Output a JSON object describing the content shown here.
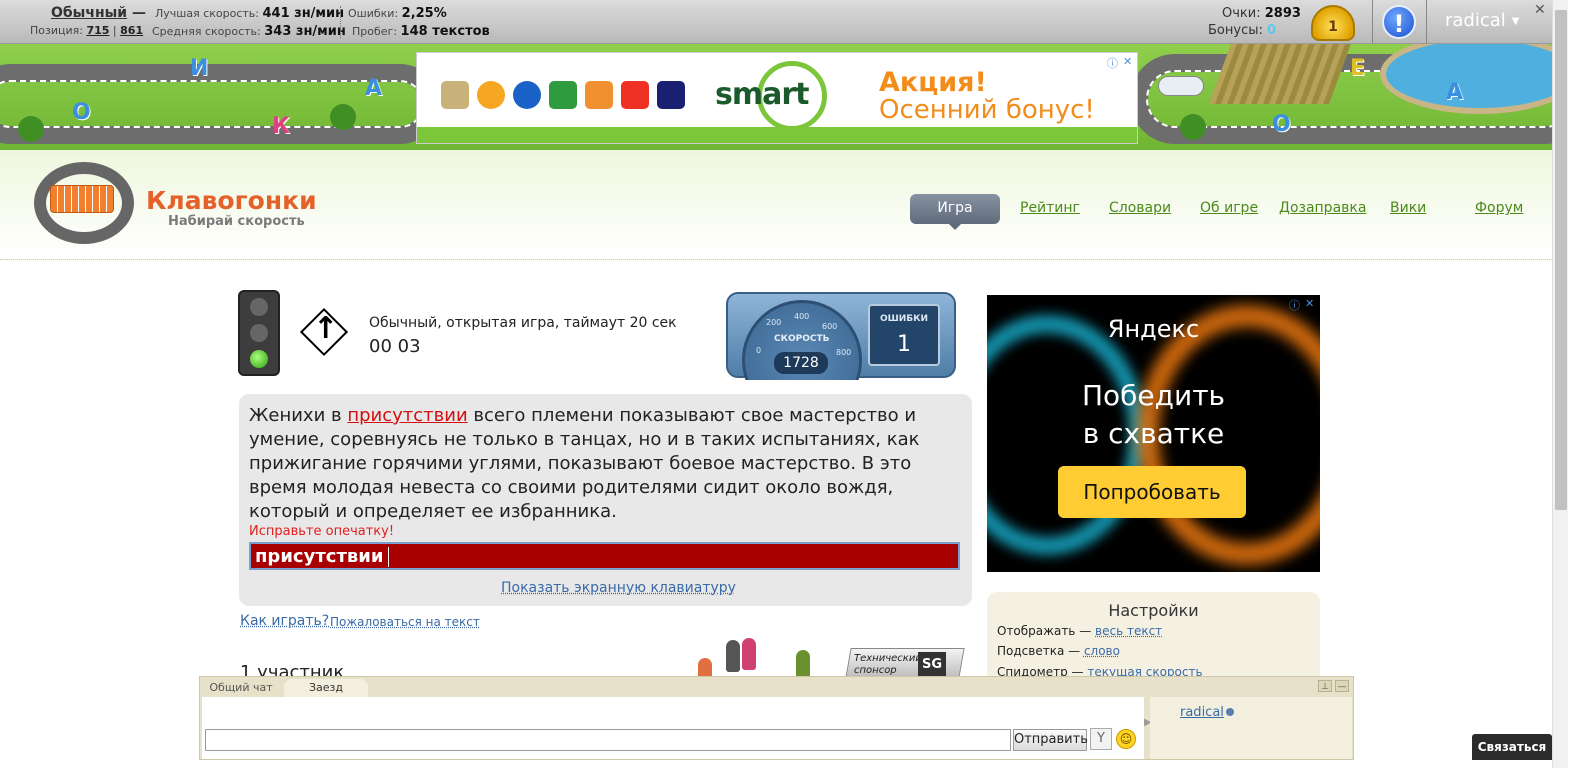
{
  "topbar": {
    "mode_label": "Обычный",
    "mode_dash": " —",
    "position_label": "Позиция: ",
    "position_current": "715",
    "position_sep": " | ",
    "position_total": "861",
    "best_speed_label": "Лучшая скорость: ",
    "best_speed_value": "441 зн/мин",
    "avg_speed_label": "Средняя скорость: ",
    "avg_speed_value": "343 зн/мин",
    "errors_label": "Ошибки: ",
    "errors_value": "2,25%",
    "mileage_label": "Пробег: ",
    "mileage_value": "148 текстов",
    "points_label": "Очки: ",
    "points_value": "2893",
    "bonus_label": "Бонусы: ",
    "bonus_value": "0",
    "level_badge": "1",
    "alert_symbol": "!",
    "username": "radical",
    "caret": "▼",
    "close_symbol": "✕"
  },
  "banner": {
    "letters": [
      "О",
      "И",
      "А",
      "К",
      "Е",
      "А",
      "О"
    ],
    "ad_title": "Акция!",
    "ad_subtitle": "Осенний бонус!",
    "ad_brand": "smart",
    "ad_ctl_info": "ⓘ",
    "ad_ctl_close": "✕",
    "payment_icons": [
      "tinkoff-icon",
      "qiwi-icon",
      "webmoney-icon",
      "sberbank-icon",
      "yandex-money-icon",
      "alfa-bank-icon",
      "visa-mastercard-icon"
    ]
  },
  "header": {
    "logo_title": "Клавогонки",
    "logo_subtitle": "Набирай скорость",
    "nav": {
      "game": "Игра",
      "rating": "Рейтинг",
      "dictionaries": "Словари",
      "about": "Об игре",
      "refuel": "Дозаправка",
      "wiki": "Вики",
      "forum": "Форум"
    }
  },
  "game": {
    "description": "Обычный, открытая игра, таймаут 20 сек",
    "timer": "00 03",
    "speedometer": {
      "caption": "СКОРОСТЬ",
      "value": "1728",
      "scale_labels": [
        "0",
        "200",
        "400",
        "600",
        "800"
      ]
    },
    "errors": {
      "caption": "ОШИБКИ",
      "value": "1"
    },
    "text_before": "Женихи в ",
    "text_current": "присутствии",
    "text_after": " всего племени показывают свое мастерство и умение, соревнуясь не только в танцах, но и в таких испытаниях, как прижигание горячими углями, показывают боевое мастерство. В это время молодая невеста со своими родителями сидит около вождя, который и определяет ее избранника.",
    "typo_message": "Исправьте опечатку!",
    "input_value": "присутствии",
    "show_keyboard_link": "Показать экранную клавиатуру",
    "how_to_play_link": "Как играть?",
    "complain_link": "Пожаловаться на текст",
    "participants": "1 участник",
    "sponsor_text": "Технический спонсор",
    "sponsor_logo": "SG"
  },
  "side_ad": {
    "brand": "Яндекс",
    "headline_line1": "Победить",
    "headline_line2": "в схватке",
    "button": "Попробовать",
    "ctl_info": "ⓘ",
    "ctl_close": "✕"
  },
  "settings": {
    "title": "Настройки",
    "rows": [
      {
        "label": "Отображать — ",
        "value": "весь текст"
      },
      {
        "label": "Подсветка — ",
        "value": "слово"
      },
      {
        "label": "Спидометр — ",
        "value": "текущая скорость"
      }
    ]
  },
  "chat": {
    "tabs": [
      "Общий чат",
      "Заезд"
    ],
    "active_tab": "Заезд",
    "input_value": "",
    "send_label": "Отправить",
    "filter_symbol": "Y",
    "smile_symbol": "☺",
    "pin_symbol": "⊥",
    "minimize_symbol": "—",
    "users": [
      "radical"
    ]
  },
  "footer": {
    "contact_button": "Связаться"
  }
}
